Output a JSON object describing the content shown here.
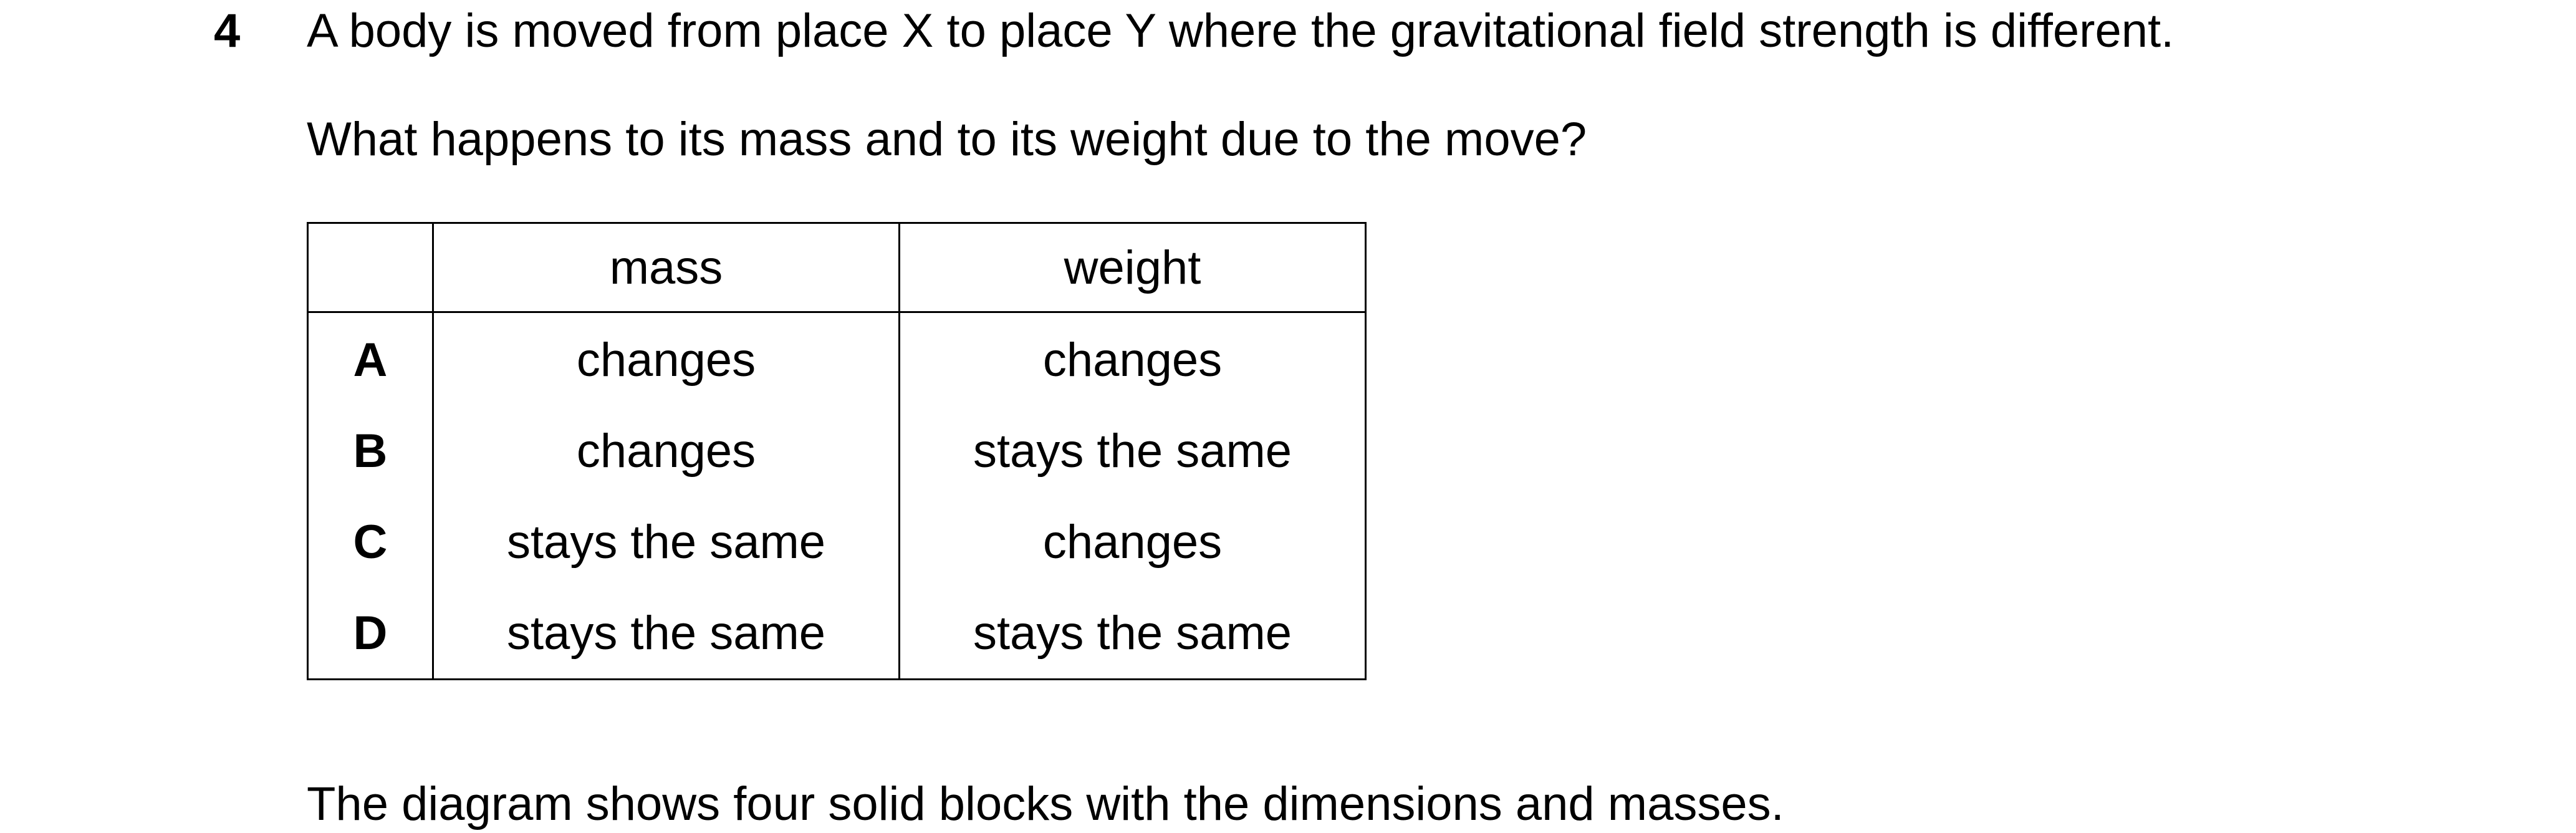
{
  "question": {
    "number": "4",
    "stem_line1": "A body is moved from place X to place Y where the gravitational field strength is different.",
    "stem_line2": "What happens to its mass and to its weight due to the move?"
  },
  "table": {
    "headers": [
      "",
      "mass",
      "weight"
    ],
    "rows": [
      {
        "letter": "A",
        "mass": "changes",
        "weight": "changes"
      },
      {
        "letter": "B",
        "mass": "changes",
        "weight": "stays the same"
      },
      {
        "letter": "C",
        "mass": "stays the same",
        "weight": "changes"
      },
      {
        "letter": "D",
        "mass": "stays the same",
        "weight": "stays the same"
      }
    ]
  },
  "cut_off_text": "The diagram shows four solid blocks with the dimensions and masses."
}
